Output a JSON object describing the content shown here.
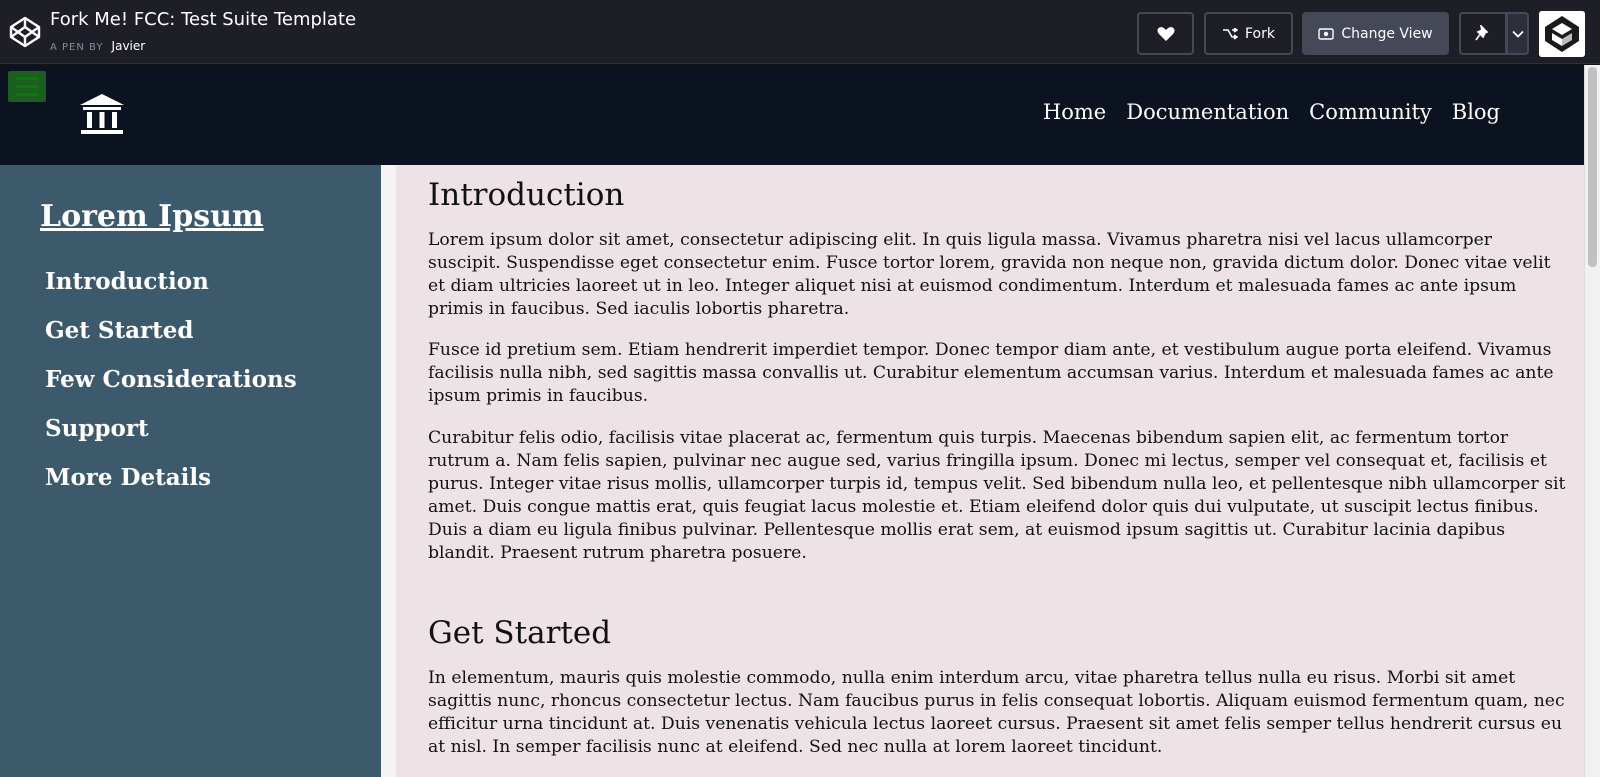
{
  "codepen": {
    "title": "Fork Me! FCC: Test Suite Template",
    "by_label": "A PEN BY",
    "author": "Javier",
    "buttons": {
      "love_icon": "heart-icon",
      "fork_label": "Fork",
      "change_view_label": "Change View",
      "pin_icon": "pin-icon"
    }
  },
  "site": {
    "nav_links": [
      "Home",
      "Documentation",
      "Community",
      "Blog"
    ],
    "sidebar": {
      "title": "Lorem Ipsum",
      "items": [
        "Introduction",
        "Get Started",
        "Few Considerations",
        "Support",
        "More Details"
      ]
    },
    "sections": [
      {
        "title": "Introduction",
        "paragraphs": [
          "Lorem ipsum dolor sit amet, consectetur adipiscing elit. In quis ligula massa. Vivamus pharetra nisi vel lacus ullamcorper suscipit. Suspendisse eget consectetur enim. Fusce tortor lorem, gravida non neque non, gravida dictum dolor. Donec vitae velit et diam ultricies laoreet ut in leo. Integer aliquet nisi at euismod condimentum. Interdum et malesuada fames ac ante ipsum primis in faucibus. Sed iaculis lobortis pharetra.",
          "Fusce id pretium sem. Etiam hendrerit imperdiet tempor. Donec tempor diam ante, et vestibulum augue porta eleifend. Vivamus facilisis nulla nibh, sed sagittis massa convallis ut. Curabitur elementum accumsan varius. Interdum et malesuada fames ac ante ipsum primis in faucibus.",
          "Curabitur felis odio, facilisis vitae placerat ac, fermentum quis turpis. Maecenas bibendum sapien elit, ac fermentum tortor rutrum a. Nam felis sapien, pulvinar nec augue sed, varius fringilla ipsum. Donec mi lectus, semper vel consequat et, facilisis et purus. Integer vitae risus mollis, ullamcorper turpis id, tempus velit. Sed bibendum nulla leo, et pellentesque nibh ullamcorper sit amet. Duis congue mattis erat, quis feugiat lacus molestie et. Etiam eleifend dolor quis dui vulputate, ut suscipit lectus finibus. Duis a diam eu ligula finibus pulvinar. Pellentesque mollis erat sem, at euismod ipsum sagittis ut. Curabitur lacinia dapibus blandit. Praesent rutrum pharetra posuere."
        ]
      },
      {
        "title": "Get Started",
        "paragraphs": [
          "In elementum, mauris quis molestie commodo, nulla enim interdum arcu, vitae pharetra tellus nulla eu risus. Morbi sit amet sagittis nunc, rhoncus consectetur lectus. Nam faucibus purus in felis consequat lobortis. Aliquam euismod fermentum quam, nec efficitur urna tincidunt at. Duis venenatis vehicula lectus laoreet cursus. Praesent sit amet felis semper tellus hendrerit cursus eu at nisl. In semper facilisis nunc at eleifend. Sed nec nulla at lorem laoreet tincidunt."
        ]
      }
    ]
  },
  "colors": {
    "codepen_bar": "#1e1f26",
    "site_nav": "#0b1220",
    "sidebar": "#3d5a6c",
    "content_bg": "#ede3e6",
    "hamburger": "#1b5e20"
  }
}
